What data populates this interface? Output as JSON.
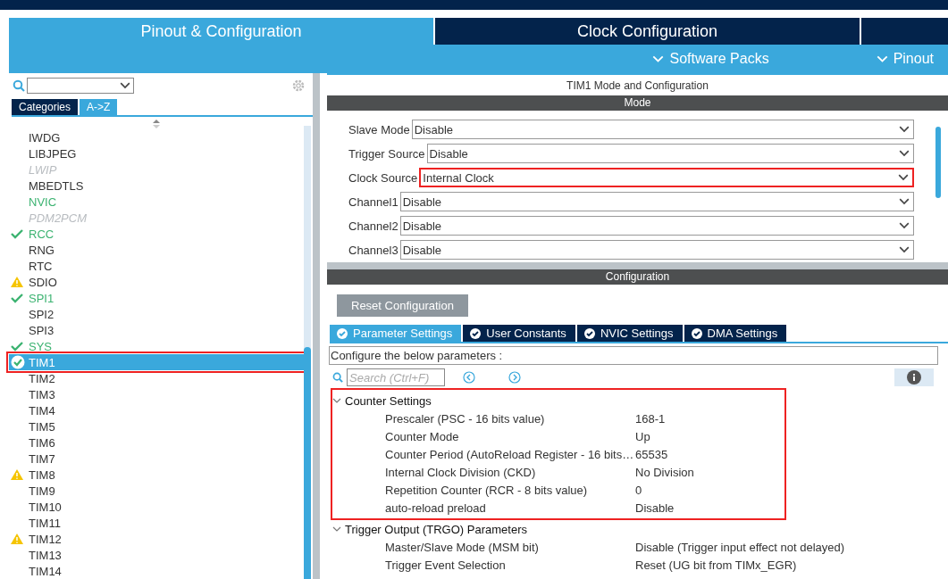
{
  "main_tabs": [
    {
      "label": "Pinout & Configuration",
      "selected": true
    },
    {
      "label": "Clock Configuration",
      "selected": false
    },
    {
      "selected": false
    }
  ],
  "sub_menu": [
    "Software Packs",
    "Pinout"
  ],
  "sidebar": {
    "view_tabs": [
      {
        "label": "Categories",
        "selected": false
      },
      {
        "label": "A->Z",
        "selected": true
      }
    ],
    "items": [
      {
        "label": "IWDG",
        "kind": "plain",
        "selected": false,
        "highlighted": false
      },
      {
        "label": "LIBJPEG",
        "kind": "plain",
        "selected": false,
        "highlighted": false
      },
      {
        "label": "LWIP",
        "kind": "unavailable",
        "selected": false,
        "highlighted": false
      },
      {
        "label": "MBEDTLS",
        "kind": "plain",
        "selected": false,
        "highlighted": false
      },
      {
        "label": "NVIC",
        "kind": "enabled",
        "selected": false,
        "highlighted": false
      },
      {
        "label": "PDM2PCM",
        "kind": "unavailable",
        "selected": false,
        "highlighted": false
      },
      {
        "label": "RCC",
        "kind": "enabled",
        "checked": true,
        "selected": false,
        "highlighted": false
      },
      {
        "label": "RNG",
        "kind": "plain",
        "selected": false,
        "highlighted": false
      },
      {
        "label": "RTC",
        "kind": "plain",
        "selected": false,
        "highlighted": false
      },
      {
        "label": "SDIO",
        "kind": "plain",
        "warning": true,
        "selected": false,
        "highlighted": false
      },
      {
        "label": "SPI1",
        "kind": "enabled",
        "checked": true,
        "selected": false,
        "highlighted": false
      },
      {
        "label": "SPI2",
        "kind": "plain",
        "selected": false,
        "highlighted": false
      },
      {
        "label": "SPI3",
        "kind": "plain",
        "selected": false,
        "highlighted": false
      },
      {
        "label": "SYS",
        "kind": "enabled",
        "checked": true,
        "selected": false,
        "highlighted": false
      },
      {
        "label": "TIM1",
        "kind": "enabled",
        "checked": true,
        "selected": true,
        "highlighted": true
      },
      {
        "label": "TIM2",
        "kind": "plain",
        "selected": false,
        "highlighted": false
      },
      {
        "label": "TIM3",
        "kind": "plain",
        "selected": false,
        "highlighted": false
      },
      {
        "label": "TIM4",
        "kind": "plain",
        "selected": false,
        "highlighted": false
      },
      {
        "label": "TIM5",
        "kind": "plain",
        "selected": false,
        "highlighted": false
      },
      {
        "label": "TIM6",
        "kind": "plain",
        "selected": false,
        "highlighted": false
      },
      {
        "label": "TIM7",
        "kind": "plain",
        "selected": false,
        "highlighted": false
      },
      {
        "label": "TIM8",
        "kind": "plain",
        "warning": true,
        "selected": false,
        "highlighted": false
      },
      {
        "label": "TIM9",
        "kind": "plain",
        "selected": false,
        "highlighted": false
      },
      {
        "label": "TIM10",
        "kind": "plain",
        "selected": false,
        "highlighted": false
      },
      {
        "label": "TIM11",
        "kind": "plain",
        "selected": false,
        "highlighted": false
      },
      {
        "label": "TIM12",
        "kind": "plain",
        "warning": true,
        "selected": false,
        "highlighted": false
      },
      {
        "label": "TIM13",
        "kind": "plain",
        "selected": false,
        "highlighted": false
      },
      {
        "label": "TIM14",
        "kind": "plain",
        "selected": false,
        "highlighted": false
      }
    ]
  },
  "panel_title": "TIM1 Mode and Configuration",
  "mode": {
    "title": "Mode",
    "fields": [
      {
        "label": "Slave Mode",
        "value": "Disable",
        "highlighted": false
      },
      {
        "label": "Trigger Source",
        "value": "Disable",
        "highlighted": false
      },
      {
        "label": "Clock Source",
        "value": "Internal Clock",
        "highlighted": true
      },
      {
        "label": "Channel1",
        "value": "Disable",
        "highlighted": false
      },
      {
        "label": "Channel2",
        "value": "Disable",
        "highlighted": false
      },
      {
        "label": "Channel3",
        "value": "Disable",
        "highlighted": false
      }
    ]
  },
  "configuration": {
    "title": "Configuration",
    "reset_button": "Reset Configuration",
    "tabs": [
      {
        "label": "Parameter Settings",
        "selected": true
      },
      {
        "label": "User Constants",
        "selected": false
      },
      {
        "label": "NVIC Settings",
        "selected": false
      },
      {
        "label": "DMA Settings",
        "selected": false
      }
    ],
    "hint": "Configure the below parameters :",
    "search": {
      "placeholder": "Search (Ctrl+F)"
    },
    "groups": [
      {
        "title": "Counter Settings",
        "expanded": true,
        "highlighted": true,
        "params": [
          {
            "name": "Prescaler (PSC - 16 bits value)",
            "value": "168-1"
          },
          {
            "name": "Counter Mode",
            "value": "Up"
          },
          {
            "name": "Counter Period (AutoReload Register - 16 bits…",
            "value": "65535"
          },
          {
            "name": "Internal Clock Division (CKD)",
            "value": "No Division"
          },
          {
            "name": "Repetition Counter (RCR - 8 bits value)",
            "value": "0"
          },
          {
            "name": "auto-reload preload",
            "value": "Disable"
          }
        ]
      },
      {
        "title": "Trigger Output (TRGO) Parameters",
        "expanded": true,
        "highlighted": false,
        "params": [
          {
            "name": "Master/Slave Mode (MSM bit)",
            "value": "Disable (Trigger input effect not delayed)"
          },
          {
            "name": "Trigger Event Selection",
            "value": "Reset (UG bit from TIMx_EGR)"
          }
        ]
      }
    ]
  }
}
